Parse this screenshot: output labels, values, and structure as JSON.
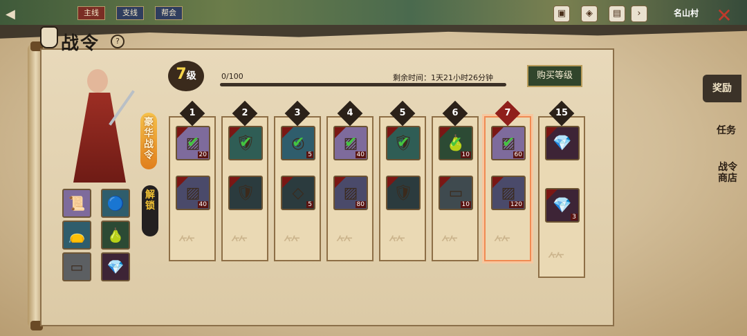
{
  "topbar": {
    "tabs": [
      "主线",
      "支线",
      "帮会"
    ],
    "village": "名山村"
  },
  "window": {
    "title": "战令",
    "help": "?"
  },
  "pass": {
    "level": "7",
    "level_unit": "级",
    "progress": "0/100",
    "progress_fraction": 0,
    "remaining": "剩余时间：1天21小时26分钟",
    "buy_label": "购买等级",
    "luxury_label": "豪华战令",
    "unlock_label": "解锁"
  },
  "side_items": [
    {
      "icon": "scroll-icon"
    },
    {
      "icon": "amulet-icon"
    },
    {
      "icon": "pouch-icon"
    },
    {
      "icon": "gourd-icon"
    },
    {
      "icon": "ingot-icon"
    },
    {
      "icon": "crystal-icon"
    }
  ],
  "columns": [
    {
      "num": "1",
      "top_qty": "20",
      "bottom_qty": "40"
    },
    {
      "num": "2",
      "top_qty": "",
      "bottom_qty": ""
    },
    {
      "num": "3",
      "top_qty": "5",
      "bottom_qty": "5"
    },
    {
      "num": "4",
      "top_qty": "40",
      "bottom_qty": "80"
    },
    {
      "num": "5",
      "top_qty": "",
      "bottom_qty": ""
    },
    {
      "num": "6",
      "top_qty": "10",
      "bottom_qty": "10"
    },
    {
      "num": "7",
      "top_qty": "60",
      "bottom_qty": "120"
    },
    {
      "num": "15",
      "top_qty": "",
      "bottom_qty": "3"
    }
  ],
  "right_tabs": [
    "奖励",
    "任务",
    "战令商店"
  ]
}
